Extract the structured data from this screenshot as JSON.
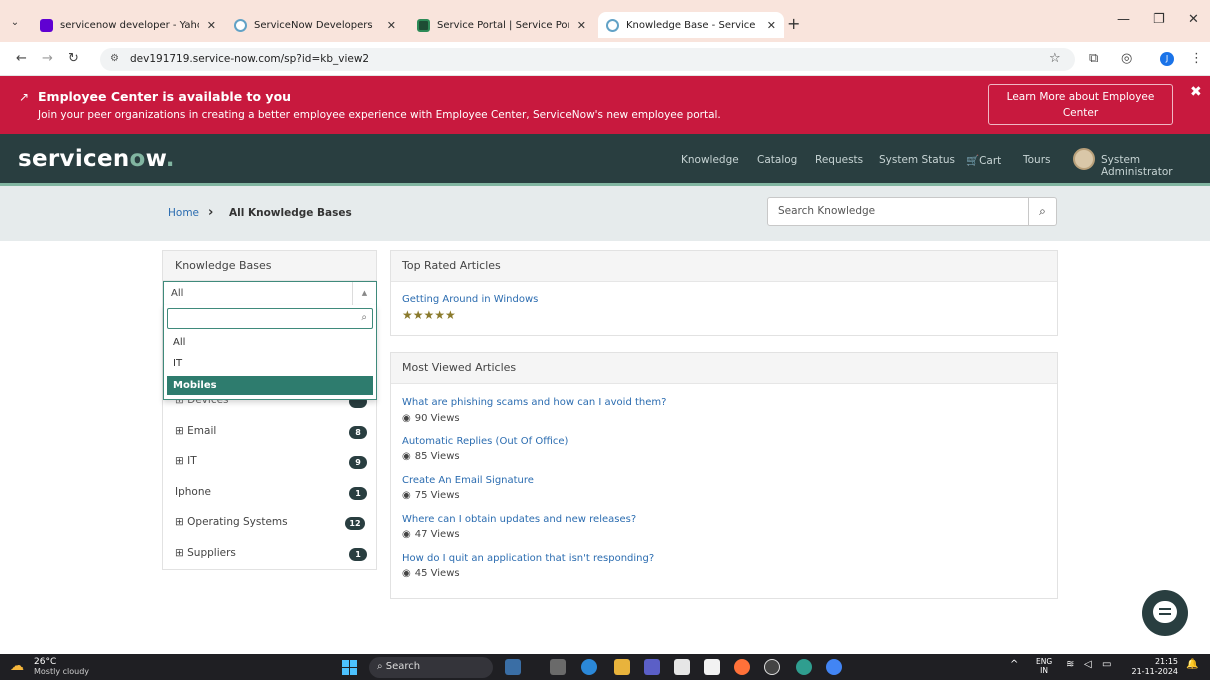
{
  "browser": {
    "tabs": [
      {
        "title": "servicenow developer - Yahoo",
        "favicon": "yahoo-icon"
      },
      {
        "title": "ServiceNow Developers",
        "favicon": "servicenow-icon"
      },
      {
        "title": "Service Portal | Service Portal | S",
        "favicon": "service-portal-icon"
      },
      {
        "title": "Knowledge Base - Service Porta",
        "favicon": "servicenow-icon",
        "active": true
      }
    ],
    "url": "dev191719.service-now.com/sp?id=kb_view2"
  },
  "banner": {
    "title": "Employee Center is available to you",
    "text": "Join your peer organizations in creating a better employee experience with Employee Center, ServiceNow's new employee portal.",
    "button_line1": "Learn More about Employee",
    "button_line2": "Center",
    "color": "#c8193e"
  },
  "header": {
    "logo_pre": "servicen",
    "logo_o": "o",
    "logo_post": "w",
    "logo_dot": ".",
    "nav": [
      "Knowledge",
      "Catalog",
      "Requests",
      "System Status",
      "Cart",
      "Tours"
    ],
    "user": "System Administrator",
    "color": "#293e40"
  },
  "breadcrumb": {
    "home": "Home",
    "current": "All Knowledge Bases"
  },
  "search": {
    "placeholder": "Search Knowledge"
  },
  "kb_panel": {
    "title": "Knowledge Bases",
    "selected": "All",
    "options": [
      "All",
      "IT",
      "Mobiles"
    ],
    "highlighted": "Mobiles",
    "categories": [
      {
        "label": "Devices",
        "count": ""
      },
      {
        "label": "Email",
        "count": "8"
      },
      {
        "label": "IT",
        "count": "9"
      },
      {
        "label": "Iphone",
        "count": "1"
      },
      {
        "label": "Operating Systems",
        "count": "12"
      },
      {
        "label": "Suppliers",
        "count": "1"
      }
    ]
  },
  "top_rated": {
    "title": "Top Rated Articles",
    "articles": [
      {
        "title": "Getting Around in Windows",
        "rating": 5
      }
    ]
  },
  "most_viewed": {
    "title": "Most Viewed Articles",
    "articles": [
      {
        "title": "What are phishing scams and how can I avoid them?",
        "views": "90 Views"
      },
      {
        "title": "Automatic Replies (Out Of Office)",
        "views": "85 Views"
      },
      {
        "title": "Create An Email Signature",
        "views": "75 Views"
      },
      {
        "title": "Where can I obtain updates and new releases?",
        "views": "47 Views"
      },
      {
        "title": "How do I quit an application that isn't responding?",
        "views": "45 Views"
      }
    ]
  },
  "taskbar": {
    "temperature": "26°C",
    "condition": "Mostly cloudy",
    "search": "Search",
    "lang1": "ENG",
    "lang2": "IN",
    "time": "21:15",
    "date": "21-11-2024"
  }
}
